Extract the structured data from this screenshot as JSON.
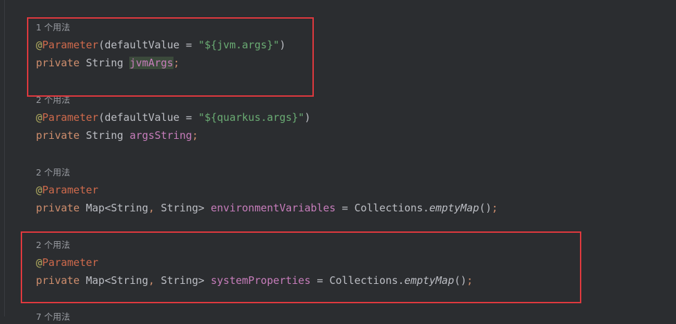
{
  "blocks": [
    {
      "usage": "1 个用法",
      "at": "@",
      "annotation": "Parameter",
      "annotation_args_open": "(defaultValue = ",
      "annotation_string": "\"${jvm.args}\"",
      "annotation_args_close": ")",
      "kw": "private",
      "type": " String ",
      "field": "jvmArgs",
      "semi": ";"
    },
    {
      "usage": "2 个用法",
      "at": "@",
      "annotation": "Parameter",
      "annotation_args_open": "(defaultValue = ",
      "annotation_string": "\"${quarkus.args}\"",
      "annotation_args_close": ")",
      "kw": "private",
      "type": " String ",
      "field": "argsString",
      "semi": ";"
    },
    {
      "usage": "2 个用法",
      "at": "@",
      "annotation": "Parameter",
      "kw": "private",
      "type_open": " Map<String",
      "comma": ",",
      "type_close": " String> ",
      "field": "environmentVariables",
      "assign": " = Collections.",
      "method": "emptyMap",
      "call": "()",
      "semi": ";"
    },
    {
      "usage": "2 个用法",
      "at": "@",
      "annotation": "Parameter",
      "kw": "private",
      "type_open": " Map<String",
      "comma": ",",
      "type_close": " String> ",
      "field": "systemProperties",
      "assign": " = Collections.",
      "method": "emptyMap",
      "call": "()",
      "semi": ";"
    },
    {
      "usage": "7 个用法"
    }
  ],
  "colors": {
    "background": "#2b2d30",
    "keyword": "#cf8e6d",
    "annotation": "#cf6a4c",
    "string": "#6aab73",
    "field": "#c77dbb",
    "highlight_box": "#e0393e"
  }
}
